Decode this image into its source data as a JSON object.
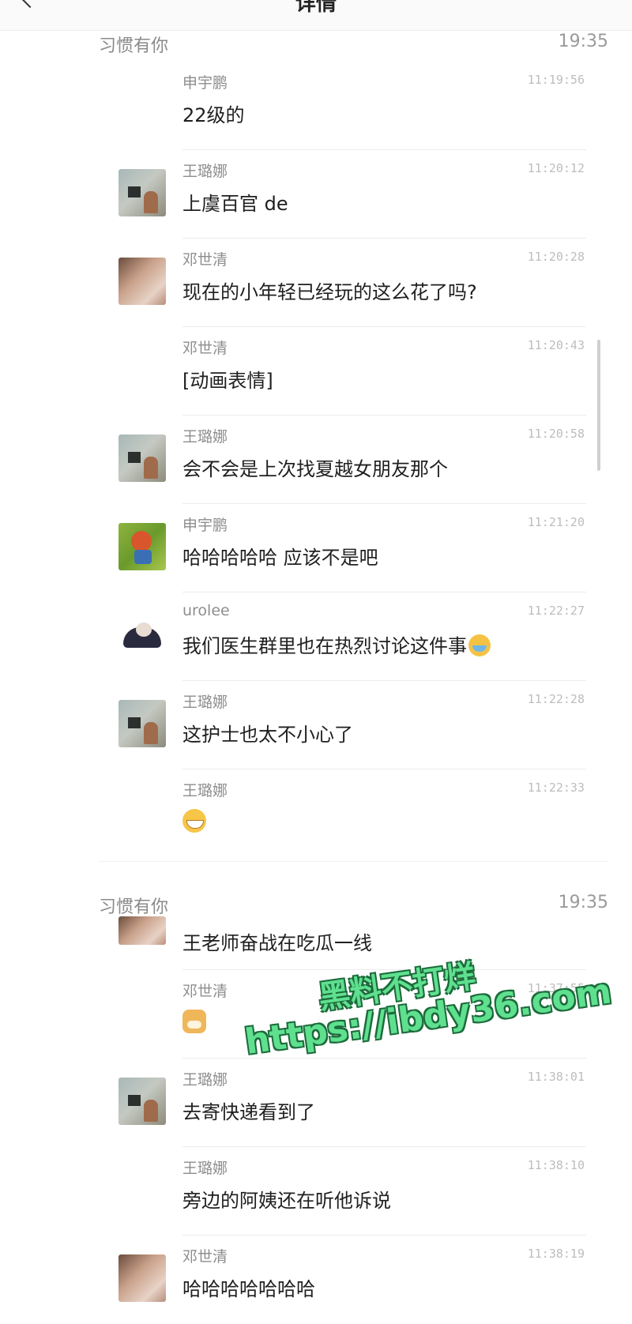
{
  "header": {
    "title": "详情"
  },
  "sections": [
    {
      "group_name": "习惯有你",
      "time": "19:35",
      "messages": [
        {
          "sender": "申宇鹏",
          "time": "11:19:56",
          "text": "22级的"
        },
        {
          "sender": "王璐娜",
          "time": "11:20:12",
          "text": "上虞百官 de"
        },
        {
          "sender": "邓世清",
          "time": "11:20:28",
          "text": "现在的小年轻已经玩的这么花了吗?"
        },
        {
          "sender": "邓世清",
          "time": "11:20:43",
          "text": "[动画表情]"
        },
        {
          "sender": "王璐娜",
          "time": "11:20:58",
          "text": "会不会是上次找夏越女朋友那个"
        },
        {
          "sender": "申宇鹏",
          "time": "11:21:20",
          "text": "哈哈哈哈哈 应该不是吧"
        },
        {
          "sender": "urolee",
          "time": "11:22:27",
          "text": "我们医生群里也在热烈讨论这件事"
        },
        {
          "sender": "王璐娜",
          "time": "11:22:28",
          "text": "这护士也太不小心了"
        },
        {
          "sender": "王璐娜",
          "time": "11:22:33",
          "emoji": "grin-emoji"
        }
      ]
    },
    {
      "group_name": "习惯有你",
      "time": "19:35",
      "messages": [
        {
          "text": "王老师奋战在吃瓜一线"
        },
        {
          "sender": "邓世清",
          "time": "11:37:55",
          "emoji": "dog-emoji"
        },
        {
          "sender": "王璐娜",
          "time": "11:38:01",
          "text": "去寄快递看到了"
        },
        {
          "sender": "王璐娜",
          "time": "11:38:10",
          "text": "旁边的阿姨还在听他诉说"
        },
        {
          "sender": "邓世清",
          "time": "11:38:19",
          "text": "哈哈哈哈哈哈哈"
        }
      ]
    }
  ],
  "watermark": {
    "line1": "黑料不打烊",
    "line2": "https://ibdy36.com"
  },
  "colors": {
    "background": "#ffffff",
    "meta_text": "#8e8e8e",
    "time_text": "#bdbdbd",
    "watermark": "#5fe08f"
  }
}
